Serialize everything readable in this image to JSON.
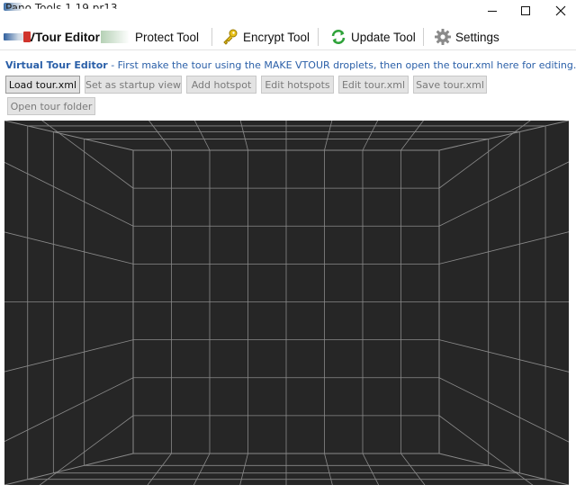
{
  "window": {
    "title": "Pano Tools 1.19.pr13"
  },
  "tabs": [
    {
      "id": "vtour",
      "label": "VTour Editor",
      "active": true
    },
    {
      "id": "protect",
      "label": "Protect Tool"
    },
    {
      "id": "encrypt",
      "label": "Encrypt Tool"
    },
    {
      "id": "update",
      "label": "Update Tool"
    },
    {
      "id": "settings",
      "label": "Settings"
    }
  ],
  "description": {
    "title": "Virtual Tour Editor",
    "text": " - First make the tour using the MAKE VTOUR droplets, then open the tour.xml here for editing."
  },
  "buttons": [
    {
      "id": "load",
      "label": "Load tour.xml",
      "enabled": true
    },
    {
      "id": "startup",
      "label": "Set as startup view",
      "enabled": false
    },
    {
      "id": "add-hotspot",
      "label": "Add hotspot",
      "enabled": false
    },
    {
      "id": "edit-hotspots",
      "label": "Edit hotspots",
      "enabled": false
    },
    {
      "id": "edit-tour",
      "label": "Edit tour.xml",
      "enabled": false
    },
    {
      "id": "save-tour",
      "label": "Save tour.xml",
      "enabled": false
    },
    {
      "id": "open-folder",
      "label": "Open tour folder",
      "enabled": false
    }
  ],
  "colors": {
    "description_text": "#2a5fa8",
    "viewer_background": "#262626",
    "grid_lines": "#8a8a8a",
    "update_icon": "#2fa23a",
    "encrypt_icon": "#e0b800"
  },
  "icons": {
    "encrypt": "key-icon",
    "update": "refresh-icon",
    "settings": "gear-icon"
  }
}
